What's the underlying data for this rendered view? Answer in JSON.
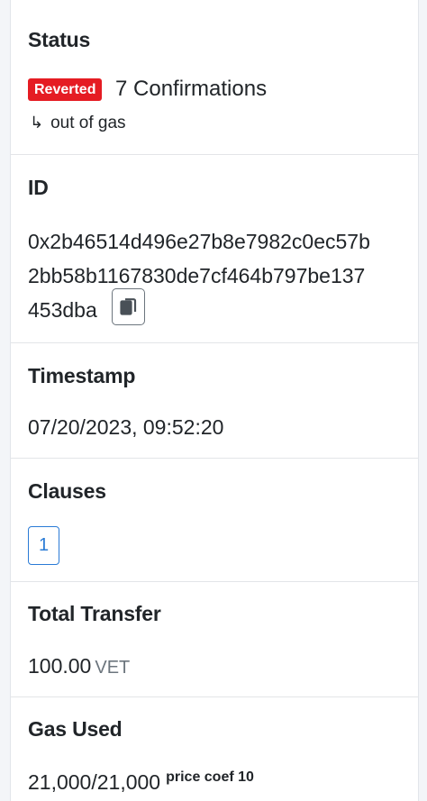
{
  "status": {
    "label": "Status",
    "badge": "Reverted",
    "badge_color": "#e51c23",
    "confirmations": "7 Confirmations",
    "sub_icon": "return-arrow-icon",
    "reason": "out of gas"
  },
  "id": {
    "label": "ID",
    "hash": "0x2b46514d496e27b8e7982c0ec57b2bb58b1167830de7cf464b797be137453dba",
    "copy_icon": "copy-icon"
  },
  "timestamp": {
    "label": "Timestamp",
    "value": "07/20/2023, 09:52:20"
  },
  "clauses": {
    "label": "Clauses",
    "count": "1",
    "accent": "#2a7bd6"
  },
  "total_transfer": {
    "label": "Total Transfer",
    "amount": "100.00",
    "unit": "VET"
  },
  "gas_used": {
    "label": "Gas Used",
    "value": "21,000/21,000",
    "price_coef": "price coef 10"
  }
}
